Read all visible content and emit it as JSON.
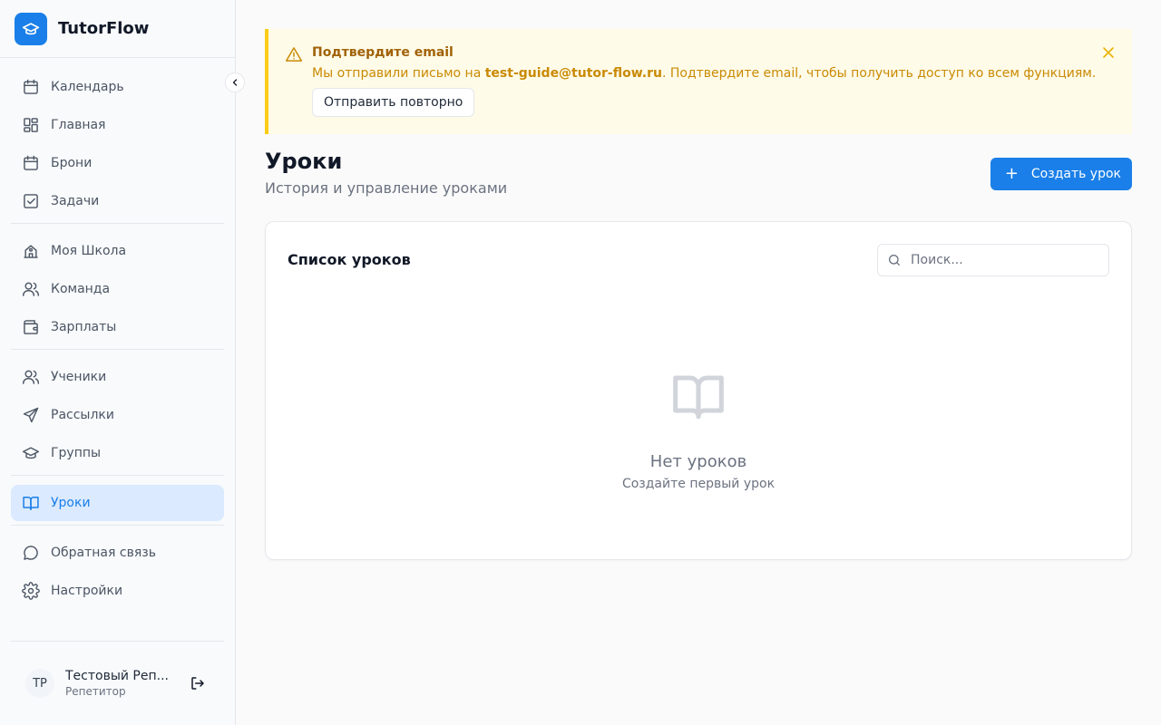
{
  "brand": {
    "name": "TutorFlow",
    "icon": "graduation-cap-icon",
    "color": "#1a7fe8"
  },
  "sidebar": {
    "groups": [
      [
        {
          "label": "Календарь",
          "icon": "calendar-icon"
        },
        {
          "label": "Главная",
          "icon": "dashboard-icon"
        },
        {
          "label": "Брони",
          "icon": "calendar-icon"
        },
        {
          "label": "Задачи",
          "icon": "checkbox-icon"
        }
      ],
      [
        {
          "label": "Моя Школа",
          "icon": "school-icon"
        },
        {
          "label": "Команда",
          "icon": "users-icon"
        },
        {
          "label": "Зарплаты",
          "icon": "wallet-icon"
        }
      ],
      [
        {
          "label": "Ученики",
          "icon": "users-icon"
        },
        {
          "label": "Рассылки",
          "icon": "send-icon"
        },
        {
          "label": "Группы",
          "icon": "graduation-cap-icon"
        }
      ],
      [
        {
          "label": "Уроки",
          "icon": "book-open-icon",
          "active": true
        }
      ],
      [
        {
          "label": "Обратная связь",
          "icon": "message-icon"
        },
        {
          "label": "Настройки",
          "icon": "gear-icon"
        }
      ]
    ]
  },
  "user": {
    "initials": "ТР",
    "name": "Тестовый Реп...",
    "role": "Репетитор"
  },
  "banner": {
    "title": "Подтвердите email",
    "text_before": "Мы отправили письмо на ",
    "email": "test-guide@tutor-flow.ru",
    "text_after": ". Подтвердите email, чтобы получить доступ ко всем функциям.",
    "resend_label": "Отправить повторно"
  },
  "page": {
    "title": "Уроки",
    "subtitle": "История и управление уроками",
    "create_label": "Создать урок"
  },
  "lessons": {
    "title": "Список уроков",
    "search_placeholder": "Поиск...",
    "empty_title": "Нет уроков",
    "empty_subtitle": "Создайте первый урок"
  },
  "colors": {
    "accent": "#1a7fe8",
    "active_bg": "#dbeafe",
    "warning_bg": "#fefbe8",
    "warning_border": "#facc15",
    "warning_text": "#ca8a04"
  }
}
